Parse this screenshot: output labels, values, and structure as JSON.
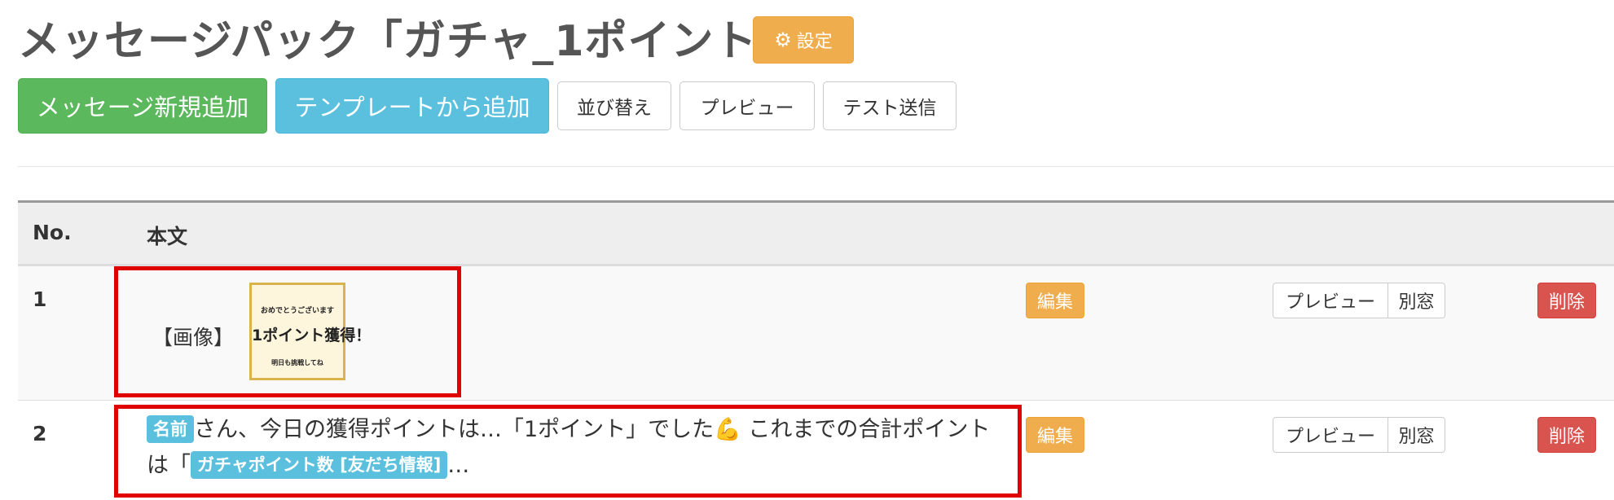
{
  "header": {
    "title": "メッセージパック「ガチャ_1ポイント」",
    "settings_label": "設定",
    "settings_icon": "gear-icon"
  },
  "toolbar": {
    "new_message": "メッセージ新規追加",
    "add_from_template": "テンプレートから追加",
    "sort": "並び替え",
    "preview": "プレビュー",
    "test_send": "テスト送信"
  },
  "table": {
    "headers": {
      "no": "No.",
      "body": "本文"
    },
    "rows": [
      {
        "no": "1",
        "type_label": "【画像】",
        "image_text": {
          "line1": "おめでとうございます",
          "line2": "1ポイント獲得！",
          "line3": "明日も挑戦してね"
        },
        "edit": "編集",
        "preview": "プレビュー",
        "new_window": "別窓",
        "delete": "削除"
      },
      {
        "no": "2",
        "tag1": "名前",
        "text1": "さん、今日の獲得ポイントは…「1ポイント」でした",
        "emoji": "💪",
        "text2": " これまでの合計ポイントは「",
        "tag2": "ガチャポイント数 [友だち情報]",
        "text3": "…",
        "edit": "編集",
        "preview": "プレビュー",
        "new_window": "別窓",
        "delete": "削除"
      }
    ]
  },
  "colors": {
    "warning": "#f0ad4e",
    "success": "#5cb85c",
    "info": "#5bc0de",
    "danger": "#d9534f",
    "highlight": "#e00000"
  }
}
